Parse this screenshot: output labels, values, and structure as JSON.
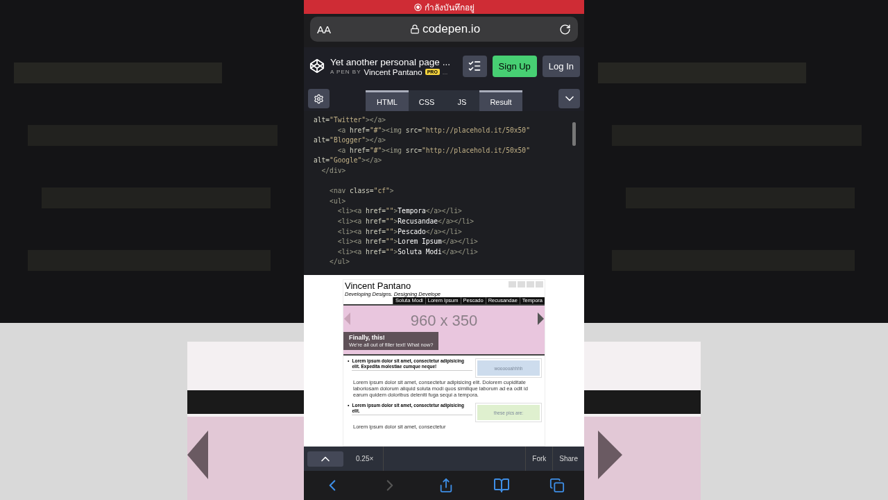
{
  "recording_banner": {
    "text": "กำลังบันทึกอยู่"
  },
  "browser_bar": {
    "text_size": "AA",
    "domain": "codepen.io"
  },
  "pen_header": {
    "title": "Yet another personal page ...",
    "byline": "A PEN BY",
    "author": "Vincent Pantano",
    "badge": "PRO",
    "more": "...",
    "buttons": [
      {
        "label": "Sign Up",
        "kind": "primary"
      },
      {
        "label": "Log In",
        "kind": "secondary"
      }
    ]
  },
  "editor_tabs": [
    {
      "label": "HTML",
      "selected": true
    },
    {
      "label": "CSS",
      "selected": false
    },
    {
      "label": "JS",
      "selected": false
    },
    {
      "label": "Result",
      "selected": true
    }
  ],
  "code_lines": [
    {
      "kind": "code",
      "tokens": [
        {
          "kind": "attr",
          "text": "alt="
        },
        {
          "kind": "str",
          "text": "\"Twitter\""
        },
        {
          "kind": "tag",
          "text": "></a>"
        }
      ]
    },
    {
      "kind": "code",
      "tokens": [
        {
          "kind": "tag",
          "text": "      <a "
        },
        {
          "kind": "attr",
          "text": "href="
        },
        {
          "kind": "str",
          "text": "\"#\""
        },
        {
          "kind": "tag",
          "text": "><img "
        },
        {
          "kind": "attr",
          "text": "src="
        },
        {
          "kind": "str",
          "text": "\"http://placehold.it/50x50\""
        }
      ]
    },
    {
      "kind": "code",
      "tokens": [
        {
          "kind": "attr",
          "text": "alt="
        },
        {
          "kind": "str",
          "text": "\"Blogger\""
        },
        {
          "kind": "tag",
          "text": "></a>"
        }
      ]
    },
    {
      "kind": "code",
      "tokens": [
        {
          "kind": "tag",
          "text": "      <a "
        },
        {
          "kind": "attr",
          "text": "href="
        },
        {
          "kind": "str",
          "text": "\"#\""
        },
        {
          "kind": "tag",
          "text": "><img "
        },
        {
          "kind": "attr",
          "text": "src="
        },
        {
          "kind": "str",
          "text": "\"http://placehold.it/50x50\""
        }
      ]
    },
    {
      "kind": "code",
      "tokens": [
        {
          "kind": "attr",
          "text": "alt="
        },
        {
          "kind": "str",
          "text": "\"Google\""
        },
        {
          "kind": "tag",
          "text": "></a>"
        }
      ]
    },
    {
      "kind": "code",
      "tokens": [
        {
          "kind": "tag",
          "text": "  </div>"
        }
      ]
    },
    {
      "kind": "blank"
    },
    {
      "kind": "code",
      "tokens": [
        {
          "kind": "tag",
          "text": "    <nav "
        },
        {
          "kind": "attr",
          "text": "class="
        },
        {
          "kind": "str",
          "text": "\"cf\""
        },
        {
          "kind": "tag",
          "text": ">"
        }
      ]
    },
    {
      "kind": "code",
      "tokens": [
        {
          "kind": "tag",
          "text": "    <ul>"
        }
      ]
    },
    {
      "kind": "code",
      "tokens": [
        {
          "kind": "tag",
          "text": "      <li><a "
        },
        {
          "kind": "attr",
          "text": "href="
        },
        {
          "kind": "str",
          "text": "\"\""
        },
        {
          "kind": "tag",
          "text": ">"
        },
        {
          "kind": "text",
          "text": "Tempora"
        },
        {
          "kind": "tag",
          "text": "</a></li>"
        }
      ]
    },
    {
      "kind": "code",
      "tokens": [
        {
          "kind": "tag",
          "text": "      <li><a "
        },
        {
          "kind": "attr",
          "text": "href="
        },
        {
          "kind": "str",
          "text": "\"\""
        },
        {
          "kind": "tag",
          "text": ">"
        },
        {
          "kind": "text",
          "text": "Recusandae"
        },
        {
          "kind": "tag",
          "text": "</a></li>"
        }
      ]
    },
    {
      "kind": "code",
      "tokens": [
        {
          "kind": "tag",
          "text": "      <li><a "
        },
        {
          "kind": "attr",
          "text": "href="
        },
        {
          "kind": "str",
          "text": "\"\""
        },
        {
          "kind": "tag",
          "text": ">"
        },
        {
          "kind": "text",
          "text": "Pescado"
        },
        {
          "kind": "tag",
          "text": "</a></li>"
        }
      ]
    },
    {
      "kind": "code",
      "tokens": [
        {
          "kind": "tag",
          "text": "      <li><a "
        },
        {
          "kind": "attr",
          "text": "href="
        },
        {
          "kind": "str",
          "text": "\"\""
        },
        {
          "kind": "tag",
          "text": ">"
        },
        {
          "kind": "text",
          "text": "Lorem Ipsum"
        },
        {
          "kind": "tag",
          "text": "</a></li>"
        }
      ]
    },
    {
      "kind": "code",
      "tokens": [
        {
          "kind": "tag",
          "text": "      <li><a "
        },
        {
          "kind": "attr",
          "text": "href="
        },
        {
          "kind": "str",
          "text": "\"\""
        },
        {
          "kind": "tag",
          "text": ">"
        },
        {
          "kind": "text",
          "text": "Soluta Modi"
        },
        {
          "kind": "tag",
          "text": "</a></li>"
        }
      ]
    },
    {
      "kind": "code",
      "tokens": [
        {
          "kind": "tag",
          "text": "    </ul>"
        }
      ]
    }
  ],
  "preview": {
    "site_title": "Vincent Pantano",
    "tagline": "Developing Designs. Designing Develope",
    "nav": [
      "Soluta Modi",
      "Lorem Ipsum",
      "Pescado",
      "Recusandae",
      "Tempora"
    ],
    "hero": {
      "size_label": "960 x 350",
      "caption_title": "Finally, this!",
      "caption_text": "We're all out of filler text! What now?"
    },
    "articles": [
      {
        "marker": "•",
        "heading": "Lorem ipsum dolor sit amet, consectetur adipisicing elit. Expedita molestiae cumque neque!",
        "body": "Lorem ipsum dolor sit amet, consectetur adipisicing elit. Dolorem cupiditate laboriosam dolorum aliquid soluta modi quos similique laborum ad ea odit id earum quidem doloribus deleniti fuga sequi a tempora.",
        "image_label": "woooooahhhh",
        "color": "#cddced"
      },
      {
        "marker": "•",
        "heading": "Lorem ipsum dolor sit amet, consectetur adipisicing elit.",
        "body": "Lorem ipsum dolor sit amet, consectetur",
        "image_label": "these pics are:",
        "color": "#dff0cf"
      }
    ]
  },
  "bottom_bar": {
    "zoom": "0.25×",
    "actions": [
      "Fork",
      "Share"
    ]
  }
}
